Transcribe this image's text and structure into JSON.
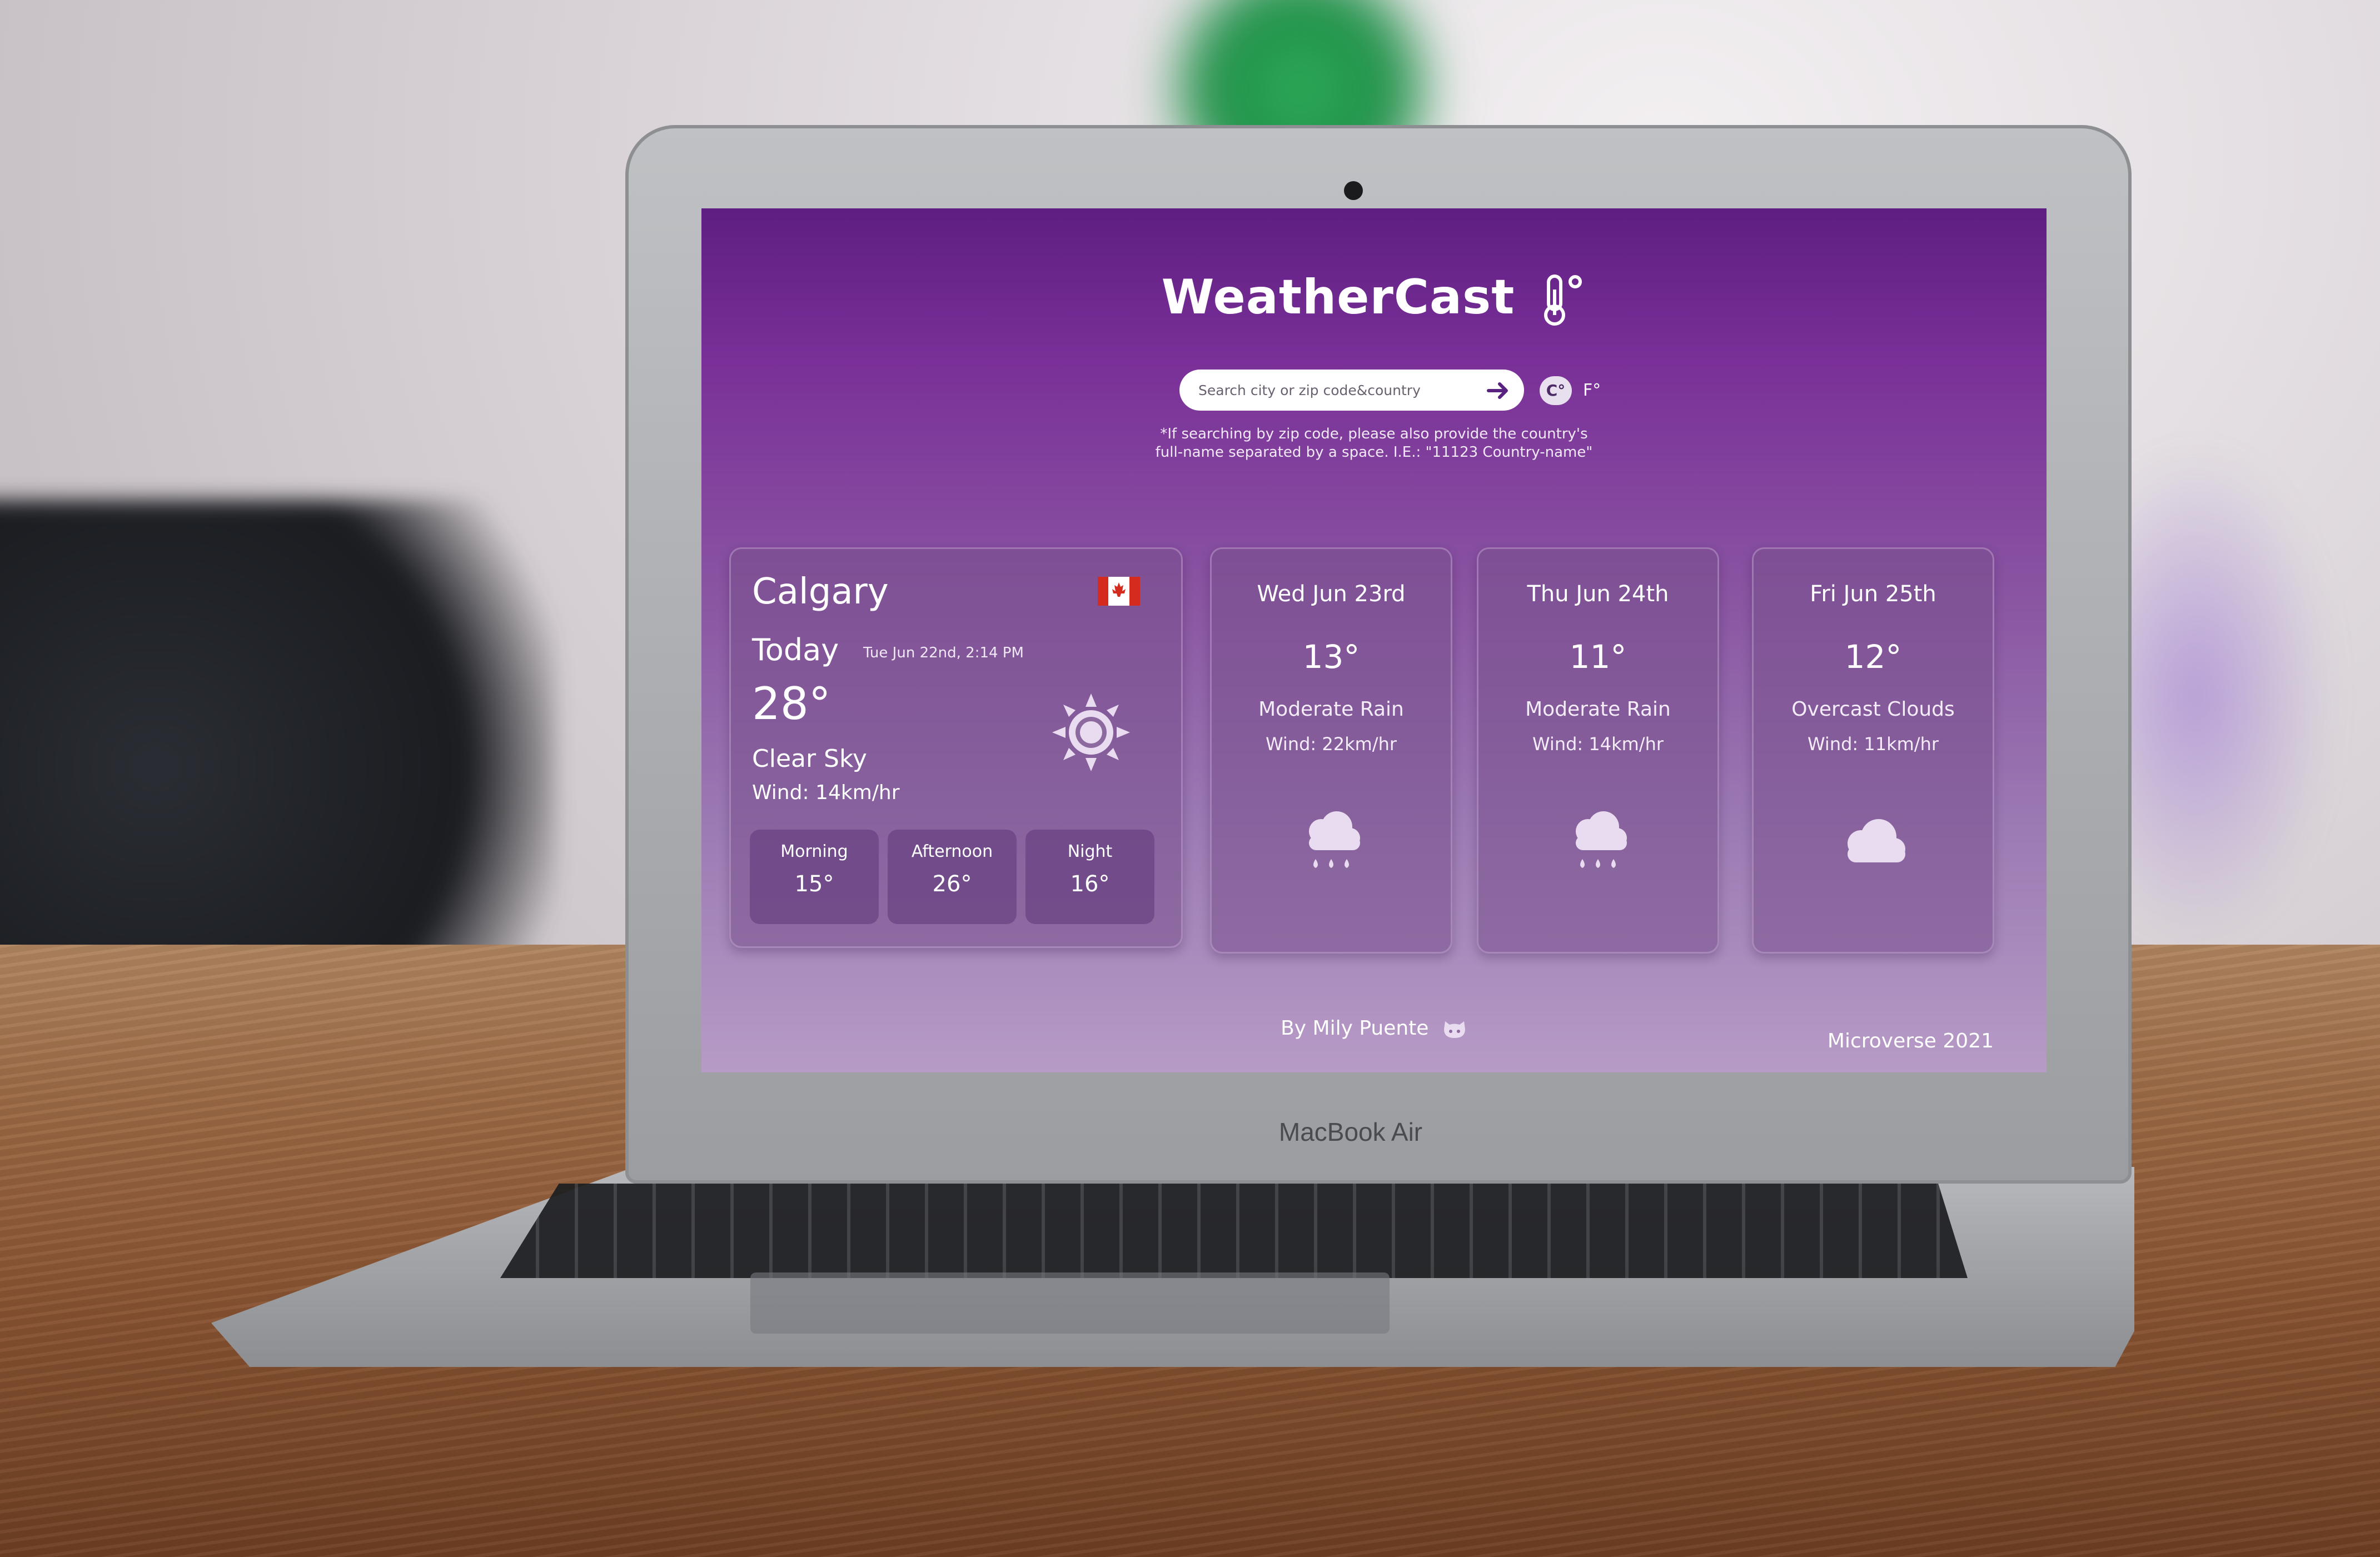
{
  "app": {
    "logo_text": "WeatherCast",
    "logo_icon": "thermometer-icon"
  },
  "search": {
    "placeholder": "Search city or zip code&country",
    "submit_icon": "arrow-right-icon",
    "unit_celsius": "C°",
    "unit_fahrenheit": "F°",
    "hint_line1": "*If searching by zip code, please also provide the country's",
    "hint_line2": "full-name separated by a space. I.E.: \"11123 Country-name\""
  },
  "today": {
    "city": "Calgary",
    "flag_icon": "canada-flag-icon",
    "label": "Today",
    "date": "Tue Jun 22nd, 2:14 PM",
    "temp": "28°",
    "condition": "Clear Sky",
    "wind": "Wind: 14km/hr",
    "icon": "sun-icon",
    "periods": [
      {
        "label": "Morning",
        "temp": "15°"
      },
      {
        "label": "Afternoon",
        "temp": "26°"
      },
      {
        "label": "Night",
        "temp": "16°"
      }
    ]
  },
  "forecast": [
    {
      "date": "Wed Jun 23rd",
      "temp": "13°",
      "condition": "Moderate Rain",
      "wind": "Wind: 22km/hr",
      "icon": "rain-cloud-icon"
    },
    {
      "date": "Thu Jun 24th",
      "temp": "11°",
      "condition": "Moderate Rain",
      "wind": "Wind: 14km/hr",
      "icon": "rain-cloud-icon"
    },
    {
      "date": "Fri Jun 25th",
      "temp": "12°",
      "condition": "Overcast Clouds",
      "wind": "Wind: 11km/hr",
      "icon": "cloud-icon"
    }
  ],
  "footer": {
    "author": "By Mily Puente",
    "author_icon": "github-icon",
    "credit": "Microverse 2021"
  },
  "device": {
    "brand": "MacBook Air"
  },
  "colors": {
    "header_purple": "#5e1e82",
    "card_bg": "#78508c",
    "text": "#ffffff"
  }
}
